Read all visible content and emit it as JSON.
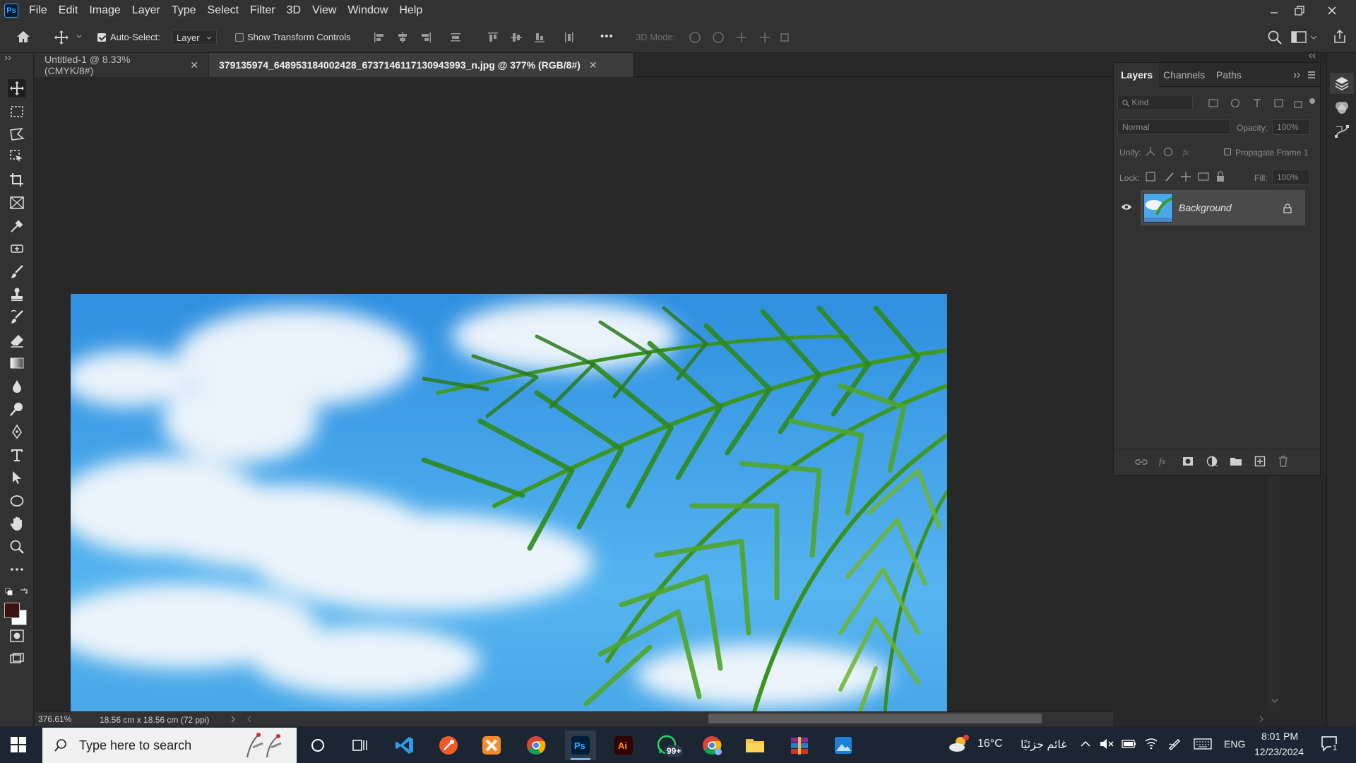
{
  "app": {
    "logo": "Ps",
    "menu": [
      "File",
      "Edit",
      "Image",
      "Layer",
      "Type",
      "Select",
      "Filter",
      "3D",
      "View",
      "Window",
      "Help"
    ]
  },
  "options": {
    "auto_select_label": "Auto-Select:",
    "auto_select_checked": true,
    "auto_select_value": "Layer",
    "show_transform_label": "Show Transform Controls",
    "show_transform_checked": false,
    "three_d_mode_label": "3D Mode:",
    "more_label": "•••"
  },
  "tabs": [
    {
      "title": "Untitled-1 @ 8.33% (CMYK/8#)",
      "active": false
    },
    {
      "title": "379135974_648953184002428_6737146117130943993_n.jpg @ 377% (RGB/8#)",
      "active": true
    }
  ],
  "status": {
    "zoom": "376.61%",
    "doc_size": "18.56 cm x 18.56 cm (72 ppi)"
  },
  "layers_panel": {
    "tabs": [
      "Layers",
      "Channels",
      "Paths"
    ],
    "active_tab": "Layers",
    "filter_kind": "Kind",
    "blend_mode": "Normal",
    "opacity_label": "Opacity:",
    "opacity_value": "100%",
    "unify_label": "Unify:",
    "propagate_label": "Propagate Frame 1",
    "lock_label": "Lock:",
    "fill_label": "Fill:",
    "fill_value": "100%",
    "layers": [
      {
        "name": "Background",
        "visible": true,
        "locked": true
      }
    ]
  },
  "taskbar": {
    "search_placeholder": "Type here to search",
    "whatsapp_badge": "99+",
    "weather_temp": "16°C",
    "weather_desc": "غائم جزئيًا",
    "lang": "ENG",
    "time": "8:01 PM",
    "date": "12/23/2024",
    "notif_count": "1",
    "colors": {
      "taskbar_bg": "#1c2633",
      "ps_accent": "#31a8ff"
    }
  },
  "colors": {
    "foreground": "#3a1212",
    "background": "#ffffff",
    "panel_bg": "#323232",
    "workspace_bg": "#282828"
  }
}
